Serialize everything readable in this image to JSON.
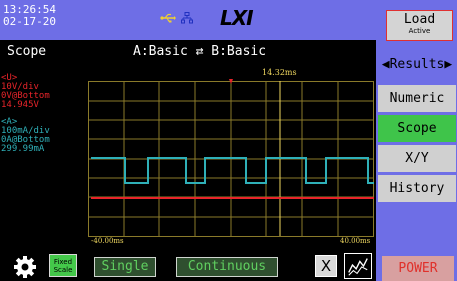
{
  "status": {
    "time": "13:26:54",
    "date": "02-17-20",
    "logo": "LXI",
    "icons": [
      "usb-icon",
      "lan-icon"
    ]
  },
  "header": {
    "mode": "Scope",
    "config": "A:Basic ⇄ B:Basic"
  },
  "channels": {
    "voltage": {
      "name": "<U>",
      "scale": "10V/div",
      "offset": "0V@Bottom",
      "value": "14.945V",
      "color": "#e8242a"
    },
    "current": {
      "name": "<A>",
      "scale": "100mA/div",
      "offset": "0A@Bottom",
      "value": "299.99mA",
      "color": "#2fb0b8"
    }
  },
  "plot": {
    "cursor_time": "14.32ms",
    "x_min_label": "-40.00ms",
    "x_max_label": "40.00ms",
    "grid_color": "#8a7a2a",
    "cursor_color": "#f0d860"
  },
  "controls": {
    "fixed_scale": "Fixed Scale",
    "single": "Single",
    "continuous": "Continuous",
    "clear": "X"
  },
  "sidebar": {
    "load": "Load",
    "load_status": "Active",
    "results": "◀Results▶",
    "numeric": "Numeric",
    "scope": "Scope",
    "xy": "X/Y",
    "history": "History",
    "power": "POWER",
    "active_tab": "Scope",
    "accent": "#6e6ee6"
  }
}
